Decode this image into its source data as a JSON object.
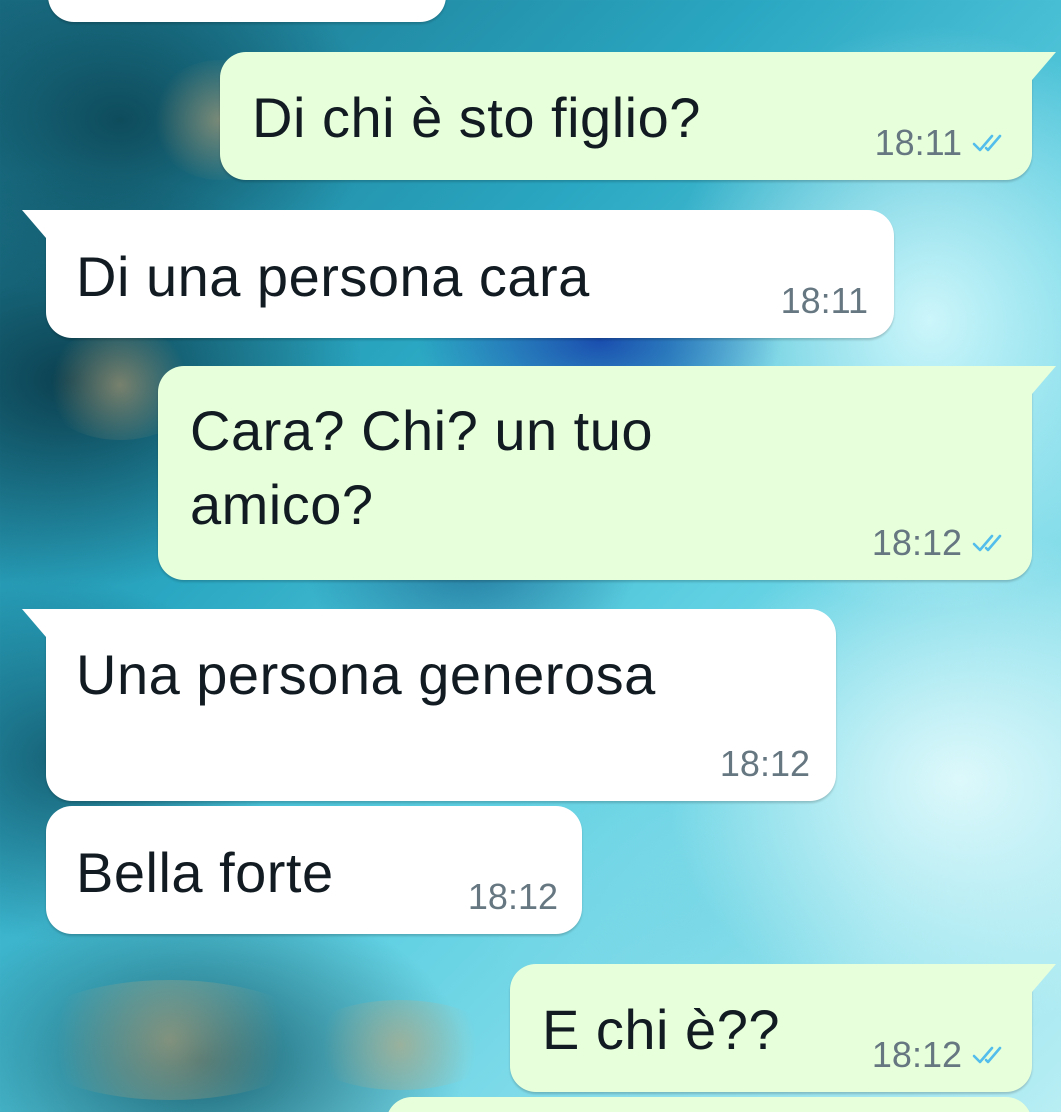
{
  "conversation": {
    "colors": {
      "outgoing_bubble": "#e7ffdb",
      "incoming_bubble": "#ffffff",
      "timestamp": "#667781",
      "read_ticks": "#53bdeb"
    },
    "messages": [
      {
        "direction": "outgoing",
        "text": "Di chi è sto figlio?",
        "time": "18:11",
        "status": "read-double-check-icon"
      },
      {
        "direction": "incoming",
        "text": "Di una persona cara",
        "time": "18:11"
      },
      {
        "direction": "outgoing",
        "text": "Cara? Chi? un tuo amico?",
        "time": "18:12",
        "status": "read-double-check-icon"
      },
      {
        "direction": "incoming",
        "text": "Una persona generosa",
        "time": "18:12"
      },
      {
        "direction": "incoming",
        "text": "Bella forte",
        "time": "18:12"
      },
      {
        "direction": "outgoing",
        "text": "E chi è??",
        "time": "18:12",
        "status": "read-double-check-icon"
      }
    ]
  }
}
